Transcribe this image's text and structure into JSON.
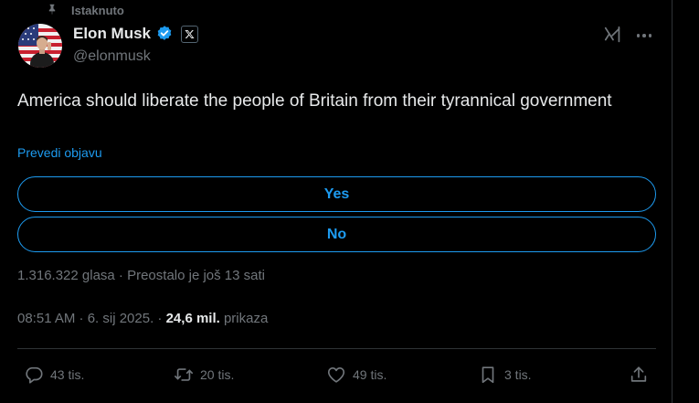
{
  "pinned_label": "Istaknuto",
  "author": {
    "display_name": "Elon Musk",
    "handle": "@elonmusk"
  },
  "tweet": {
    "text": "America should liberate the people of Britain from their tyrannical government",
    "translate_label": "Prevedi objavu"
  },
  "poll": {
    "options": [
      {
        "label": "Yes"
      },
      {
        "label": "No"
      }
    ],
    "meta": "1.316.322 glasa · Preostalo je još 13 sati"
  },
  "timestamp": {
    "text": "08:51 AM · 6. sij 2025. · ",
    "views_count": "24,6 mil.",
    "views_label": " prikaza"
  },
  "actions": {
    "replies": "43 tis.",
    "reposts": "20 tis.",
    "likes": "49 tis.",
    "bookmarks": "3 tis."
  },
  "colors": {
    "background": "#000000",
    "accent": "#1d9bf0",
    "text_primary": "#e7e9ea",
    "text_secondary": "#71767b",
    "divider": "#2f3336"
  },
  "icons": [
    "pin-icon",
    "verified-badge-icon",
    "x-logo-icon",
    "grok-icon",
    "more-icon",
    "reply-icon",
    "repost-icon",
    "like-icon",
    "bookmark-icon",
    "share-icon"
  ]
}
